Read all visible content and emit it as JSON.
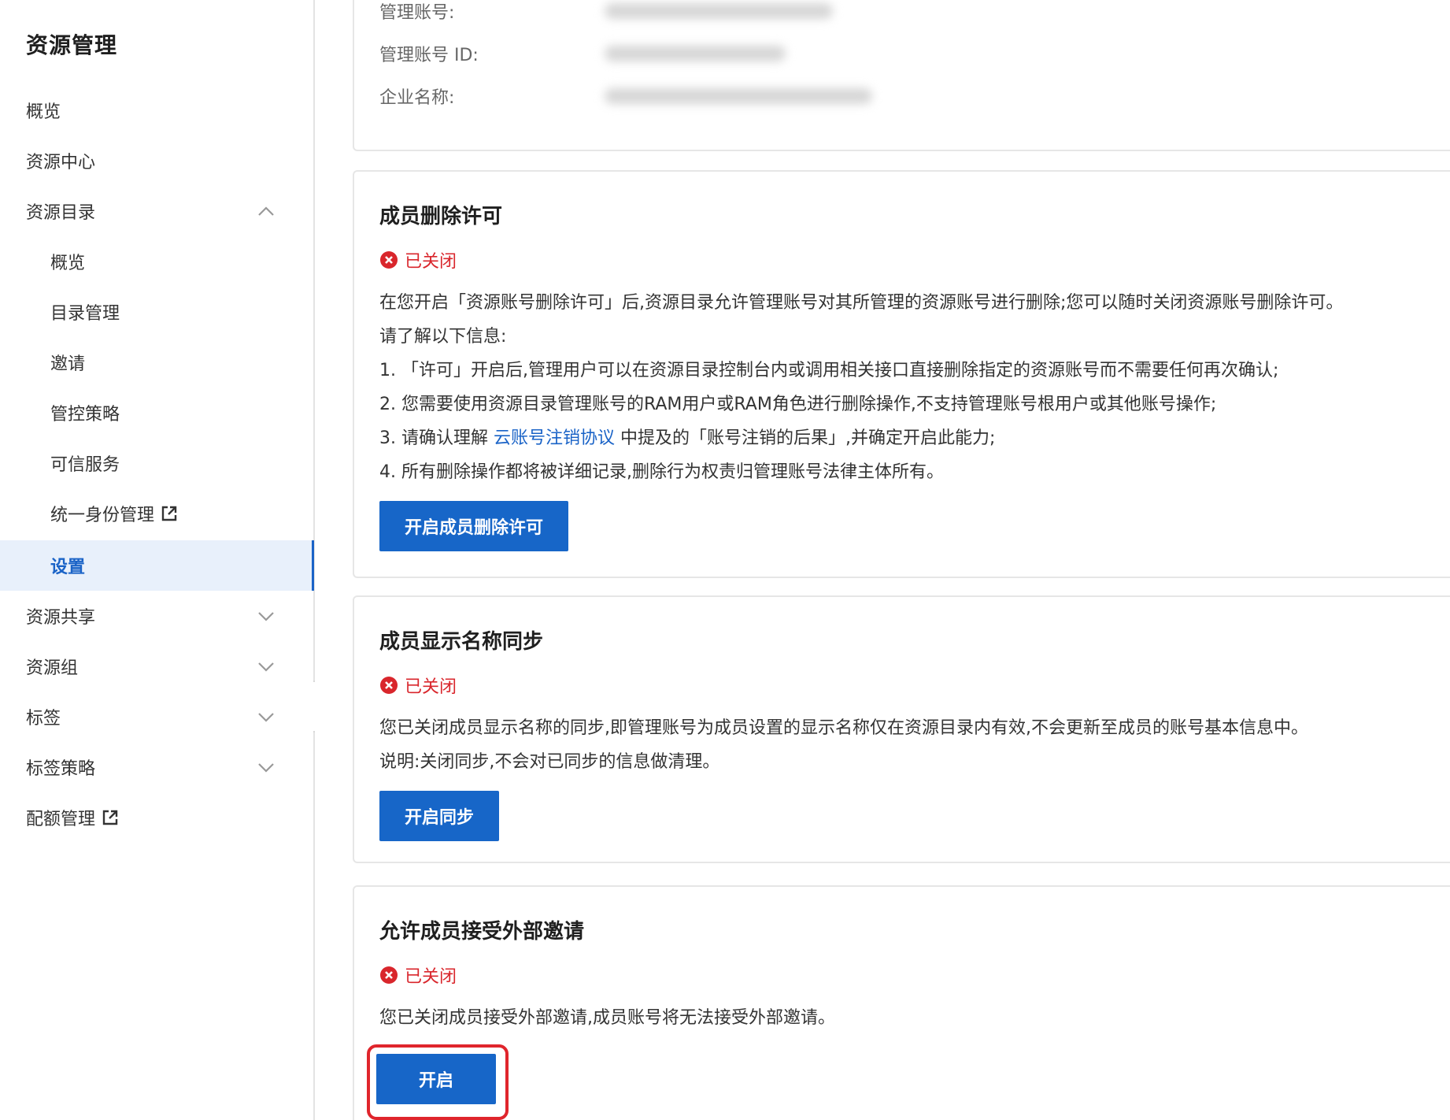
{
  "sidebar": {
    "title": "资源管理",
    "items": [
      {
        "label": "概览"
      },
      {
        "label": "资源中心"
      },
      {
        "label": "资源目录"
      },
      {
        "label": "概览"
      },
      {
        "label": "目录管理"
      },
      {
        "label": "邀请"
      },
      {
        "label": "管控策略"
      },
      {
        "label": "可信服务"
      },
      {
        "label": "统一身份管理"
      },
      {
        "label": "设置"
      },
      {
        "label": "资源共享"
      },
      {
        "label": "资源组"
      },
      {
        "label": "标签"
      },
      {
        "label": "标签策略"
      },
      {
        "label": "配额管理"
      }
    ],
    "active_item": "设置",
    "expanded_item": "资源目录"
  },
  "account_info": {
    "admin_account_label": "管理账号:",
    "admin_account_id_label": "管理账号 ID:",
    "company_name_label": "企业名称:"
  },
  "cards": [
    {
      "title": "成员删除许可",
      "status": "已关闭",
      "paragraphs": [
        "在您开启「资源账号删除许可」后,资源目录允许管理账号对其所管理的资源账号进行删除;您可以随时关闭资源账号删除许可。",
        "请了解以下信息:",
        "1. 「许可」开启后,管理用户可以在资源目录控制台内或调用相关接口直接删除指定的资源账号而不需要任何再次确认;",
        "2. 您需要使用资源目录管理账号的RAM用户或RAM角色进行删除操作,不支持管理账号根用户或其他账号操作;",
        "4. 所有删除操作都将被详细记录,删除行为权责归管理账号法律主体所有。"
      ],
      "item3_prefix": "3. 请确认理解 ",
      "item3_link": "云账号注销协议",
      "item3_suffix": " 中提及的「账号注销的后果」,并确定开启此能力;",
      "button": "开启成员删除许可"
    },
    {
      "title": "成员显示名称同步",
      "status": "已关闭",
      "paragraphs": [
        "您已关闭成员显示名称的同步,即管理账号为成员设置的显示名称仅在资源目录内有效,不会更新至成员的账号基本信息中。",
        "说明:关闭同步,不会对已同步的信息做清理。"
      ],
      "button": "开启同步"
    },
    {
      "title": "允许成员接受外部邀请",
      "status": "已关闭",
      "paragraphs": [
        "您已关闭成员接受外部邀请,成员账号将无法接受外部邀请。"
      ],
      "button": "开启"
    }
  ],
  "colors": {
    "accent": "#1766c8",
    "link": "#1a63c7",
    "status_closed": "#d9262c",
    "highlight": "#e0252c",
    "active_bg": "#e8f0fb"
  },
  "icons": {
    "collapse": "chevron-left-icon",
    "expand": "chevron-down-icon",
    "collapse_menu": "chevron-up-icon",
    "external": "external-link-icon",
    "status": "close-circle-icon"
  }
}
